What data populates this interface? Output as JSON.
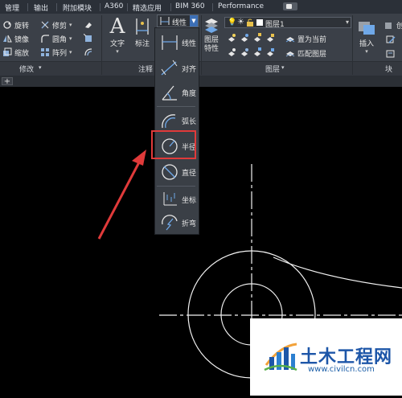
{
  "tabs": [
    "管理",
    "输出",
    "附加模块",
    "A360",
    "精选应用",
    "BIM 360",
    "Performance"
  ],
  "ribbon": {
    "modify": {
      "title": "修改",
      "items": [
        "旋转",
        "修剪",
        "镜像",
        "圆角",
        "缩放",
        "阵列"
      ]
    },
    "annotation": {
      "title": "注释",
      "text_label": "文字",
      "dim_label": "标注"
    },
    "layers": {
      "title": "图层",
      "layer_props_label": "图层\n特性",
      "current_layer": "图层1",
      "set_current": "置为当前",
      "match_layer": "匹配图层"
    },
    "block": {
      "title": "块",
      "insert_label": "插入",
      "create_label": "创"
    }
  },
  "dim_dropdown": {
    "selected": "线性",
    "items": [
      "线性",
      "对齐",
      "角度",
      "弧长",
      "半径",
      "直径",
      "坐标",
      "折弯"
    ],
    "highlighted": "半径"
  },
  "doc_tab_label": "+",
  "watermark": {
    "title": "土木工程网",
    "url": "www.civilcn.com"
  },
  "colors": {
    "ribbon_bg": "#3b4048",
    "accent": "#3c6fb6",
    "highlight": "#e03a3a",
    "icon_blue": "#6fa8e8",
    "drawing_line": "#f2f2f2"
  }
}
